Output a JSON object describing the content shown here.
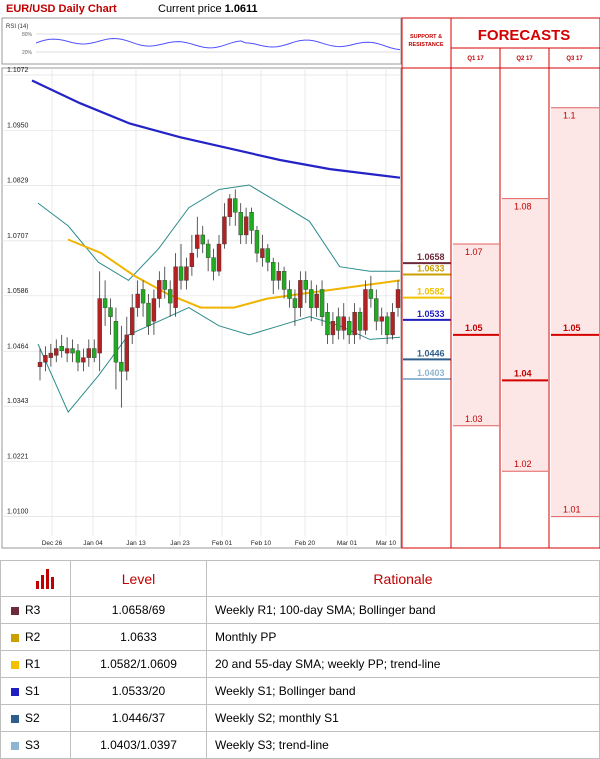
{
  "header": {
    "title": "EUR/USD Daily Chart",
    "price_label": "Current price",
    "price_value": "1.0611"
  },
  "rsi": {
    "label": "RSI (14)",
    "tick_labels": [
      "80%",
      "20%"
    ]
  },
  "support_resistance_header": "SUPPORT & RESISTANCE",
  "forecasts_header": "FORECASTS",
  "colors": {
    "r3": "#6b2b3a",
    "r2": "#c8a000",
    "r1": "#f2c200",
    "s1": "#1f1fc0",
    "s2": "#2e5f8c",
    "s3": "#8fb6d0",
    "forecast_line": "#d40000",
    "forecast_fill": "#fde6e6",
    "sma200": "#2323c8",
    "sma55": "#f0b400",
    "bollinger": "#2e8b8b",
    "bull": "#22aa22",
    "bear": "#b22222"
  },
  "chart_data": {
    "type": "candlestick",
    "title": "EUR/USD Daily Chart",
    "ylim": [
      1.0031,
      1.1072
    ],
    "y_ticks": [
      "1.1072",
      "1.0950",
      "1.0829",
      "1.0707",
      "1.0586",
      "1.0464",
      "1.0343",
      "1.0221",
      "1.0100"
    ],
    "x_ticks": [
      "Dec 26",
      "Jan 04",
      "Jan 13",
      "Jan 23",
      "Feb 01",
      "Feb 10",
      "Feb 20",
      "Mar 01",
      "Mar 10"
    ],
    "levels": [
      {
        "name": "R3",
        "label": "1.0658",
        "value": 1.0658
      },
      {
        "name": "R2",
        "label": "1.0633",
        "value": 1.0633
      },
      {
        "name": "R1",
        "label": "1.0582",
        "value": 1.0582
      },
      {
        "name": "S1",
        "label": "1.0533",
        "value": 1.0533
      },
      {
        "name": "S2",
        "label": "1.0446",
        "value": 1.0446
      },
      {
        "name": "S3",
        "label": "1.0403",
        "value": 1.0403
      }
    ],
    "forecasts": [
      {
        "period": "Q1 17",
        "high": "1.07",
        "mid": "1.05",
        "low": "1.03",
        "high_v": 1.07,
        "mid_v": 1.05,
        "low_v": 1.03
      },
      {
        "period": "Q2 17",
        "high": "1.08",
        "mid": "1.04",
        "low": "1.02",
        "high_v": 1.08,
        "mid_v": 1.04,
        "low_v": 1.02
      },
      {
        "period": "Q3 17",
        "high": "1.1",
        "mid": "1.05",
        "low": "1.01",
        "high_v": 1.1,
        "mid_v": 1.05,
        "low_v": 1.01
      }
    ],
    "sma200": [
      1.106,
      1.101,
      1.0965,
      1.0935,
      1.091,
      1.0885,
      1.0865,
      1.0846
    ],
    "sma55": [
      1.071,
      1.068,
      1.063,
      1.059,
      1.056,
      1.056,
      1.058,
      1.059,
      1.06,
      1.061,
      1.062
    ],
    "bb_upper": [
      1.079,
      1.074,
      1.066,
      1.062,
      1.069,
      1.078,
      1.082,
      1.083,
      1.079,
      1.075,
      1.065,
      1.064,
      1.064
    ],
    "bb_lower": [
      1.048,
      1.033,
      1.041,
      1.05,
      1.053,
      1.056,
      1.052,
      1.05,
      1.052,
      1.054,
      1.052,
      1.049,
      1.0495
    ],
    "candles": [
      [
        1.044,
        1.043,
        1.047,
        1.04
      ],
      [
        1.0455,
        1.044,
        1.0475,
        1.042
      ],
      [
        1.046,
        1.045,
        1.048,
        1.043
      ],
      [
        1.047,
        1.0455,
        1.049,
        1.044
      ],
      [
        1.0465,
        1.0475,
        1.05,
        1.045
      ],
      [
        1.047,
        1.046,
        1.0495,
        1.044
      ],
      [
        1.046,
        1.047,
        1.049,
        1.044
      ],
      [
        1.044,
        1.0465,
        1.048,
        1.042
      ],
      [
        1.045,
        1.044,
        1.047,
        1.042
      ],
      [
        1.047,
        1.045,
        1.049,
        1.043
      ],
      [
        1.045,
        1.047,
        1.049,
        1.044
      ],
      [
        1.058,
        1.046,
        1.064,
        1.042
      ],
      [
        1.056,
        1.058,
        1.062,
        1.052
      ],
      [
        1.054,
        1.056,
        1.058,
        1.05
      ],
      [
        1.044,
        1.053,
        1.056,
        1.038
      ],
      [
        1.042,
        1.044,
        1.052,
        1.034
      ],
      [
        1.05,
        1.042,
        1.054,
        1.04
      ],
      [
        1.056,
        1.05,
        1.059,
        1.048
      ],
      [
        1.059,
        1.056,
        1.062,
        1.054
      ],
      [
        1.057,
        1.06,
        1.062,
        1.054
      ],
      [
        1.052,
        1.057,
        1.059,
        1.05
      ],
      [
        1.058,
        1.053,
        1.06,
        1.05
      ],
      [
        1.062,
        1.058,
        1.064,
        1.056
      ],
      [
        1.06,
        1.062,
        1.065,
        1.058
      ],
      [
        1.057,
        1.06,
        1.062,
        1.054
      ],
      [
        1.065,
        1.056,
        1.068,
        1.054
      ],
      [
        1.062,
        1.065,
        1.07,
        1.06
      ],
      [
        1.065,
        1.062,
        1.067,
        1.06
      ],
      [
        1.068,
        1.065,
        1.072,
        1.063
      ],
      [
        1.072,
        1.069,
        1.076,
        1.067
      ],
      [
        1.07,
        1.072,
        1.074,
        1.068
      ],
      [
        1.067,
        1.07,
        1.071,
        1.064
      ],
      [
        1.064,
        1.067,
        1.069,
        1.062
      ],
      [
        1.07,
        1.064,
        1.072,
        1.063
      ],
      [
        1.076,
        1.07,
        1.079,
        1.069
      ],
      [
        1.08,
        1.076,
        1.081,
        1.074
      ],
      [
        1.077,
        1.08,
        1.082,
        1.074
      ],
      [
        1.072,
        1.077,
        1.079,
        1.07
      ],
      [
        1.076,
        1.072,
        1.078,
        1.07
      ],
      [
        1.073,
        1.077,
        1.078,
        1.07
      ],
      [
        1.068,
        1.073,
        1.074,
        1.066
      ],
      [
        1.069,
        1.067,
        1.072,
        1.065
      ],
      [
        1.066,
        1.069,
        1.07,
        1.064
      ],
      [
        1.062,
        1.066,
        1.067,
        1.059
      ],
      [
        1.064,
        1.062,
        1.066,
        1.06
      ],
      [
        1.06,
        1.064,
        1.065,
        1.058
      ],
      [
        1.058,
        1.06,
        1.062,
        1.056
      ],
      [
        1.056,
        1.058,
        1.06,
        1.052
      ],
      [
        1.062,
        1.056,
        1.064,
        1.054
      ],
      [
        1.06,
        1.062,
        1.064,
        1.057
      ],
      [
        1.056,
        1.06,
        1.062,
        1.053
      ],
      [
        1.059,
        1.056,
        1.061,
        1.054
      ],
      [
        1.054,
        1.06,
        1.062,
        1.052
      ],
      [
        1.05,
        1.055,
        1.057,
        1.048
      ],
      [
        1.053,
        1.05,
        1.055,
        1.048
      ],
      [
        1.051,
        1.054,
        1.056,
        1.049
      ],
      [
        1.054,
        1.051,
        1.057,
        1.049
      ],
      [
        1.05,
        1.053,
        1.054,
        1.048
      ],
      [
        1.055,
        1.05,
        1.057,
        1.048
      ],
      [
        1.051,
        1.055,
        1.056,
        1.049
      ],
      [
        1.06,
        1.051,
        1.062,
        1.05
      ],
      [
        1.058,
        1.06,
        1.063,
        1.056
      ],
      [
        1.053,
        1.058,
        1.06,
        1.051
      ],
      [
        1.054,
        1.053,
        1.056,
        1.05
      ],
      [
        1.05,
        1.054,
        1.055,
        1.048
      ],
      [
        1.055,
        1.05,
        1.057,
        1.049
      ],
      [
        1.06,
        1.056,
        1.062,
        1.054
      ]
    ]
  },
  "table": {
    "header_level": "Level",
    "header_rationale": "Rationale",
    "rows": [
      {
        "name": "R3",
        "level": "1.0658/69",
        "rationale": "Weekly R1; 100-day SMA; Bollinger band"
      },
      {
        "name": "R2",
        "level": "1.0633",
        "rationale": "Monthly PP"
      },
      {
        "name": "R1",
        "level": "1.0582/1.0609",
        "rationale": "20 and 55-day SMA; weekly PP; trend-line"
      },
      {
        "name": "S1",
        "level": "1.0533/20",
        "rationale": "Weekly S1; Bollinger band"
      },
      {
        "name": "S2",
        "level": "1.0446/37",
        "rationale": "Weekly S2; monthly S1"
      },
      {
        "name": "S3",
        "level": "1.0403/1.0397",
        "rationale": "Weekly S3; trend-line"
      }
    ]
  }
}
